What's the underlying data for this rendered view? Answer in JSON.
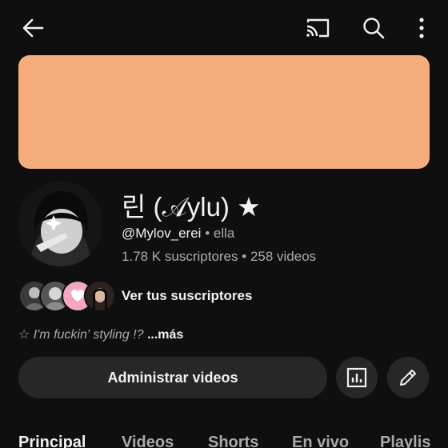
{
  "header": {
    "back_icon": "arrow-left-icon",
    "cast_icon": "cast-icon",
    "search_icon": "search-icon",
    "more_icon": "more-vertical-icon"
  },
  "banner": {
    "color": "#f5ad7d"
  },
  "channel": {
    "name": "린 (𝒜ylu) ★",
    "handle": "@Mylov_erei",
    "separator": "•",
    "pronouns": "ella",
    "subscribers": "1.78 K suscriptores",
    "videos": "258 videos"
  },
  "subscribers_row": {
    "link_label": "Ver tus suscriptores"
  },
  "description": {
    "text": "☆ I'm fuckin' styling !?",
    "more_label": "...más"
  },
  "actions": {
    "manage_label": "Administrar videos",
    "stats_icon": "analytics-icon",
    "edit_icon": "pencil-icon"
  },
  "tabs": [
    {
      "label": "Principal"
    },
    {
      "label": "Videos"
    },
    {
      "label": "Shorts"
    },
    {
      "label": "En vivo"
    },
    {
      "label": "Playlis"
    }
  ]
}
